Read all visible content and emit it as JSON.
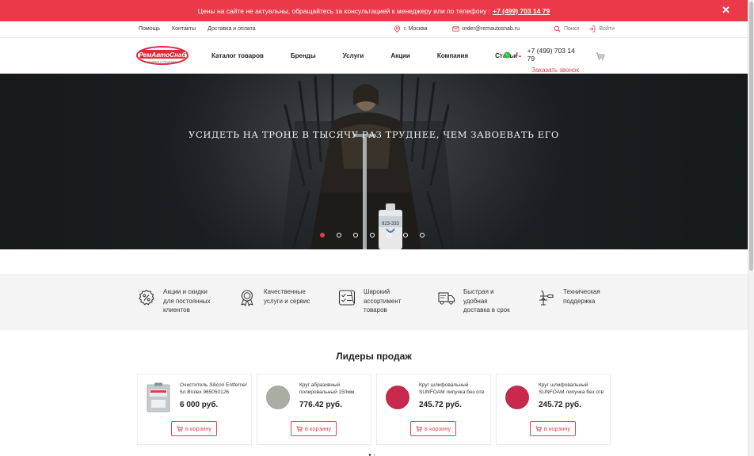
{
  "notice": {
    "text": "Цены на сайте не актуальны, обращайтесь за консультацией к менеджеру или по телефону :",
    "phone": "+7 (499) 703 14 79",
    "close_glyph": "✕"
  },
  "topbar": {
    "links": [
      "Помощь",
      "Контакты",
      "Доставка и оплата"
    ],
    "city": "г. Москва",
    "email": "order@remautosnab.ru",
    "search_label": "Поиск",
    "login_label": "Войти"
  },
  "header": {
    "logo_text": "РемАвтоСнаб",
    "logo_tagline": "Автоэмали и оборудование",
    "nav": [
      "Каталог товаров",
      "Бренды",
      "Услуги",
      "Акции",
      "Компания",
      "Статьи"
    ],
    "phone": "+7 (499) 703 14 79",
    "callback_label": "Заказать звонок",
    "icons": [
      "whatsapp-icon",
      "phone-icon",
      "cart-icon"
    ]
  },
  "hero": {
    "title": "Усидеть на троне в тысячу раз труднее, чем завоевать его",
    "slides_count": 7,
    "active_slide": 1
  },
  "features": [
    {
      "icon": "discount-icon",
      "text": "Акции и скидки для постоянных клиентов"
    },
    {
      "icon": "award-icon",
      "text": "Качественные услуги и сервис"
    },
    {
      "icon": "checklist-icon",
      "text": "Широкий ассортимент товаров"
    },
    {
      "icon": "truck-icon",
      "text": "Быстрая и удобная доставка в срок"
    },
    {
      "icon": "support-icon",
      "text": "Техническая поддержка"
    }
  ],
  "leaders": {
    "title": "Лидеры продаж",
    "buy_label": "в корзину",
    "products": [
      {
        "name": "Очиститель Silicon Entferner 5л Brulex 965050126",
        "price": "6 000 руб.",
        "thumb": "can"
      },
      {
        "name": "Круг абразивный полировальный 150мм",
        "price": "776.42 руб.",
        "thumb": "grey-disc"
      },
      {
        "name": "Круг шлифовальный SUNFOAM липучка без отв",
        "price": "245.72 руб.",
        "thumb": "red-disc"
      },
      {
        "name": "Круг шлифовальный SUNFOAM липучка без отв",
        "price": "245.72 руб.",
        "thumb": "red-disc"
      }
    ]
  },
  "colors": {
    "accent": "#ea3a4a",
    "hero_bg": "#2c3033",
    "features_bg": "#f4f4f4"
  }
}
